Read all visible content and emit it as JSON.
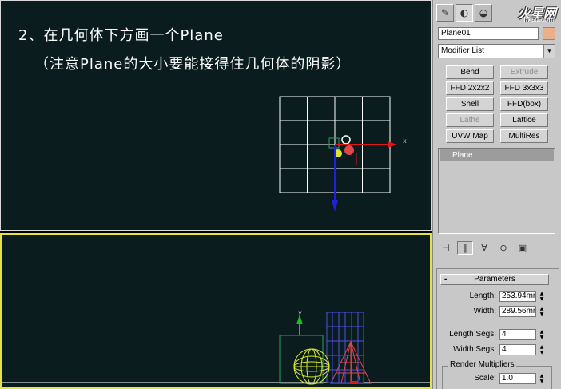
{
  "tutorial": {
    "step": "2、在几何体下方画一个Plane",
    "note": "（注意Plane的大小要能接得住几何体的阴影）"
  },
  "viewport_top": {
    "name": "top-viewport"
  },
  "viewport_bottom": {
    "name": "front-viewport",
    "axis_y": "y"
  },
  "axis_x_label": "x",
  "panel": {
    "logo": "火星网",
    "logo_sub": "hxsd.com",
    "tabs": [
      "create-tab",
      "modify-tab",
      "hierarchy-tab",
      "motion-tab"
    ],
    "object_name": "Plane01",
    "object_color": "#e9b08a",
    "modifier_list": "Modifier List",
    "modifiers": [
      {
        "label": "Bend",
        "enabled": true
      },
      {
        "label": "Extrude",
        "enabled": false
      },
      {
        "label": "FFD 2x2x2",
        "enabled": true
      },
      {
        "label": "FFD 3x3x3",
        "enabled": true
      },
      {
        "label": "Shell",
        "enabled": true
      },
      {
        "label": "FFD(box)",
        "enabled": true
      },
      {
        "label": "Lathe",
        "enabled": false
      },
      {
        "label": "Lattice",
        "enabled": true
      },
      {
        "label": "UVW Map",
        "enabled": true
      },
      {
        "label": "MultiRes",
        "enabled": true
      }
    ],
    "stack_item": "Plane",
    "rollout_title": "Parameters",
    "rollout_minus": "-",
    "params": {
      "length_label": "Length:",
      "length_value": "253.94mm",
      "width_label": "Width:",
      "width_value": "289.56mm",
      "length_segs_label": "Length Segs:",
      "length_segs_value": "4",
      "width_segs_label": "Width Segs:",
      "width_segs_value": "4"
    },
    "render_multipliers": {
      "title": "Render Multipliers",
      "scale_label": "Scale:",
      "scale_value": "1.0"
    }
  },
  "colors": {
    "viewport_bg": "#0b1c1f",
    "active_border": "#e6e04a",
    "grid": "#ffffff",
    "axis_x": "#e01818",
    "axis_y": "#2020e0",
    "axis_z": "#18c018"
  }
}
